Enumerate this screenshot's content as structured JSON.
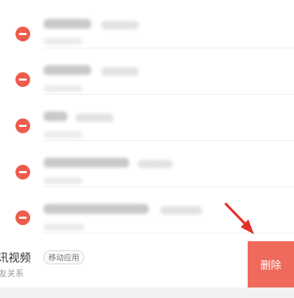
{
  "list": {
    "rows": [
      {
        "state": "blurred"
      },
      {
        "state": "blurred"
      },
      {
        "state": "blurred"
      },
      {
        "state": "blurred"
      },
      {
        "state": "blurred"
      }
    ]
  },
  "swiped_item": {
    "name": "讯视频",
    "tag": "移动应用",
    "subtitle": "友关系",
    "delete_label": "删除"
  },
  "colors": {
    "remove_icon": "#ef5b4c",
    "delete_button": "#ef6a5c",
    "arrow": "#e0332b"
  },
  "icons": {
    "remove": "minus-circle-icon",
    "annotation": "red-arrow-icon"
  }
}
